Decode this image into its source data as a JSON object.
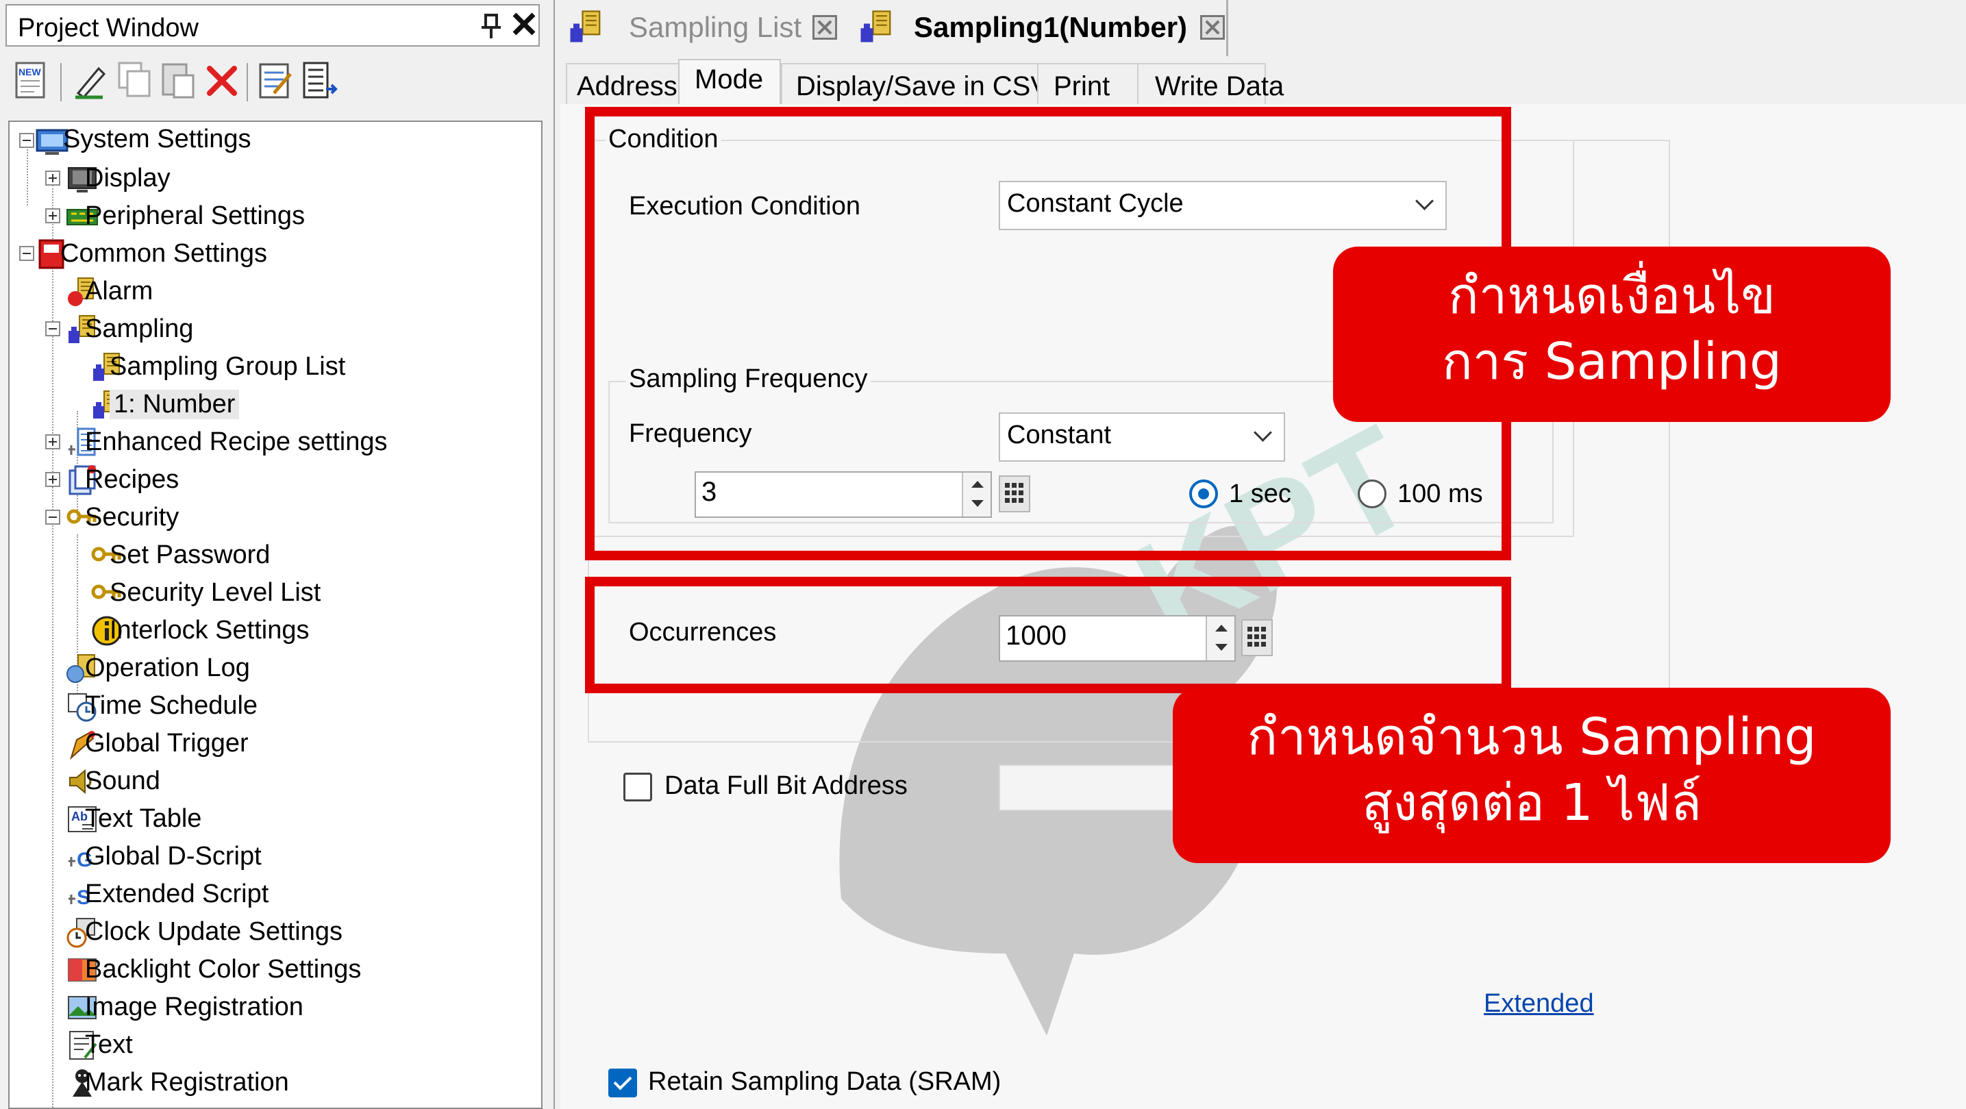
{
  "project_window": {
    "title": "Project Window",
    "pin_glyph": "⇩",
    "close_glyph": "✕",
    "toolbar": [
      {
        "icon": "new-icon"
      },
      {
        "icon": "edit-pen-icon"
      },
      {
        "icon": "copy-icon"
      },
      {
        "icon": "paste-icon"
      },
      {
        "icon": "delete-icon"
      },
      {
        "icon": "properties-icon"
      },
      {
        "icon": "list-export-icon"
      }
    ],
    "tree": [
      "System Settings",
      "Display",
      "Peripheral Settings",
      "Common Settings",
      "Alarm",
      "Sampling",
      "Sampling Group List",
      "1: Number",
      "Enhanced Recipe settings",
      "Recipes",
      "Security",
      "Set Password",
      "Security Level List",
      "Interlock Settings",
      "Operation Log",
      "Time Schedule",
      "Global Trigger",
      "Sound",
      "Text Table",
      "Global D-Script",
      "Extended Script",
      "Clock Update Settings",
      "Backlight Color Settings",
      "Image Registration",
      "Text",
      "Mark Registration"
    ]
  },
  "doc_tabs": [
    {
      "label": "Sampling List",
      "active": false
    },
    {
      "label": "Sampling1(Number)",
      "active": true
    }
  ],
  "sub_tabs": [
    "Address",
    "Mode",
    "Display/Save in CSV",
    "Print",
    "Write Data"
  ],
  "active_sub_tab": "Mode",
  "mode": {
    "condition_group": "Condition",
    "execution_condition_label": "Execution Condition",
    "execution_condition_value": "Constant Cycle",
    "sampling_frequency_group": "Sampling Frequency",
    "frequency_label": "Frequency",
    "frequency_value": "Constant",
    "interval_value": "3",
    "unit_options": [
      "1 sec",
      "100 ms"
    ],
    "unit_selected": "1 sec",
    "occurrences_label": "Occurrences",
    "occurrences_value": "1000",
    "data_full_bit_label": "Data Full Bit Address",
    "data_full_bit_checked": false,
    "extended_link": "Extended",
    "retain_label": "Retain Sampling Data (SRAM)",
    "retain_checked": true
  },
  "callouts": {
    "condition": {
      "line1": "กำหนดเงื่อนไข",
      "line2": "การ Sampling"
    },
    "occurrences": {
      "line1": "กำหนดจำนวน Sampling",
      "line2": "สูงสุดต่อ 1 ไฟล์"
    }
  },
  "colors": {
    "highlight_red": "#e00000",
    "callout_red": "#e60000",
    "accent_blue": "#0067c0",
    "link_blue": "#0645ad"
  }
}
